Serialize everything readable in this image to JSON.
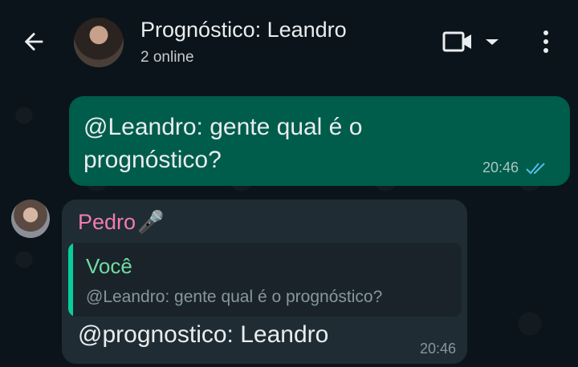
{
  "header": {
    "title": "Prognóstico: Leandro",
    "subtitle": "2 online"
  },
  "messages": {
    "outgoing": {
      "text": "@Leandro: gente qual é o prognóstico?",
      "time": "20:46",
      "status": "read"
    },
    "incoming": {
      "sender": "Pedro",
      "sender_emoji": "🎤",
      "quote": {
        "author": "Você",
        "text": "@Leandro: gente qual é o prognóstico?"
      },
      "text": "@prognostico: Leandro",
      "time": "20:46"
    }
  },
  "colors": {
    "outgoing_bubble": "#005c4b",
    "incoming_bubble": "#1f2c34",
    "sender_name": "#f07cb2",
    "quote_accent": "#06cf9c",
    "read_ticks": "#53bdeb"
  },
  "icons": [
    "back-arrow-icon",
    "video-call-icon",
    "dropdown-caret-icon",
    "more-vert-icon",
    "double-check-icon"
  ]
}
